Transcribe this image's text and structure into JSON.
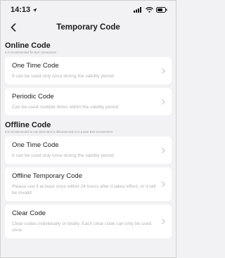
{
  "status": {
    "time": "14:13"
  },
  "nav": {
    "title": "Temporary Code"
  },
  "online": {
    "title": "Online Code",
    "subtitle": "It is recommended for BLE connections",
    "items": [
      {
        "title": "One Time Code",
        "desc": "It can be used only once during the validity period"
      },
      {
        "title": "Periodic Code",
        "desc": "Can be used multiple times within the validity period"
      }
    ]
  },
  "offline": {
    "title": "Offline Code",
    "subtitle": "It is recommended to use when BLE is disconnected or in a poor BLE environment",
    "items": [
      {
        "title": "One Time Code",
        "desc": "It can be used only once during the validity period"
      },
      {
        "title": "Offline Temporary Code",
        "desc": "Please use it at least once within 24 hours after it takes effect, or it will be invalid"
      },
      {
        "title": "Clear Code",
        "desc": "Clear codes individually or totally. Each clear code can only be used once"
      }
    ]
  },
  "colors": {
    "background": "#f2f2f4",
    "card": "#ffffff",
    "muted_text": "#b3b3b3"
  }
}
